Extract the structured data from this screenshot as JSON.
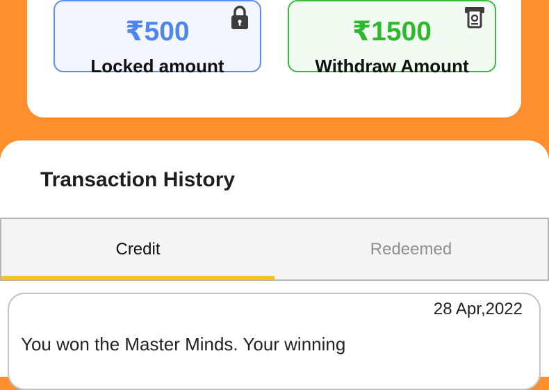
{
  "wallet": {
    "locked": {
      "value": "₹500",
      "label": "Locked amount",
      "icon": "lock-icon"
    },
    "withdraw": {
      "value": "₹1500",
      "label": "Withdraw Amount",
      "icon": "atm-icon"
    }
  },
  "history": {
    "title": "Transaction History",
    "tabs": [
      {
        "label": "Credit",
        "active": true
      },
      {
        "label": "Redeemed",
        "active": false
      }
    ],
    "transactions": [
      {
        "date": "28 Apr,2022",
        "text": "You won the Master Minds. Your winning"
      }
    ]
  },
  "colors": {
    "background": "#ff8f2e",
    "locked_accent": "#4f86ee",
    "withdraw_accent": "#2fb82f",
    "tab_indicator": "#f6c21c"
  }
}
